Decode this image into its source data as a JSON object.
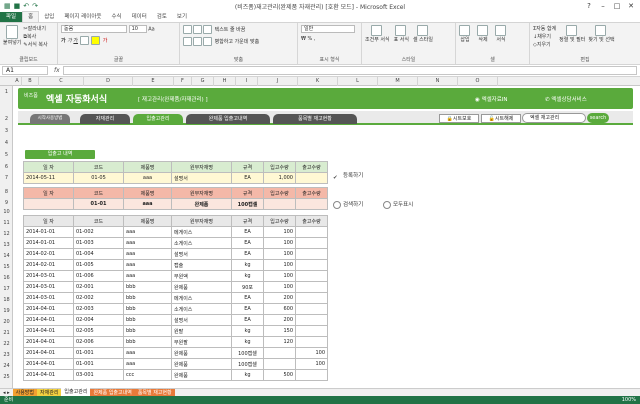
{
  "window": {
    "title": "(비즈폼)재고관리(완제품 자재관리) [호환 모드] - Microsoft Excel"
  },
  "tabs": [
    "파일",
    "홈",
    "삽입",
    "페이지 레이아웃",
    "수식",
    "데이터",
    "검토",
    "보기"
  ],
  "ribbon": {
    "clipboard": {
      "label": "클립보드",
      "paste": "붙여넣기",
      "cut": "잘라내기",
      "copy": "복사",
      "format_painter": "서식 복사"
    },
    "font": {
      "label": "글꼴",
      "font_name": "돋움",
      "font_size": "10"
    },
    "align": {
      "label": "맞춤",
      "wrap": "텍스트 줄 바꿈",
      "merge": "병합하고 가운데 맞춤"
    },
    "number": {
      "label": "표시 형식",
      "format": "일반"
    },
    "styles": {
      "label": "스타일",
      "cond": "조건부 서식",
      "table": "표 서식",
      "cell": "셀 스타일"
    },
    "cells": {
      "label": "셀",
      "insert": "삽입",
      "delete": "삭제",
      "format": "서식"
    },
    "edit": {
      "label": "편집",
      "autosum": "자동 합계",
      "fill": "채우기",
      "clear": "지우기",
      "sort": "정렬 및 필터",
      "find": "찾기 및 선택"
    }
  },
  "formula": {
    "namebox": "A1",
    "fx": "fx"
  },
  "columns": [
    "A",
    "B",
    "C",
    "D",
    "E",
    "F",
    "G",
    "H",
    "I",
    "J",
    "K",
    "L",
    "M",
    "N",
    "O"
  ],
  "rows": [
    "1",
    "2",
    "3",
    "4",
    "5",
    "6",
    "7",
    "8",
    "9",
    "10",
    "11",
    "12",
    "13",
    "14",
    "15",
    "16",
    "17",
    "18",
    "19",
    "20",
    "21",
    "22",
    "23",
    "24",
    "25",
    "26",
    "27",
    "28",
    "29"
  ],
  "banner": {
    "logo": "비즈폼",
    "title": "엑셀 자동화서식",
    "subtitle": "[ 재고관리(완제품/자재관리) ]",
    "brand1": "엑셀자료IN",
    "brand2": "엑셀상담서비스"
  },
  "nav": {
    "tabs": [
      "시작사용방법",
      "자재관리",
      "입출고관리",
      "완제품 입출고내역",
      "품목별 재고현황"
    ],
    "protect": "시트보호",
    "unprotect": "시트해제",
    "search_placeholder": "엑셀 재고관리",
    "search_btn": "search"
  },
  "section": {
    "label": "입출고 내역"
  },
  "input_table": {
    "headers": [
      "일 자",
      "코드",
      "제품명",
      "원부자재명",
      "규격",
      "입고수량",
      "출고수량"
    ],
    "row": [
      "2014-05-11",
      "01-05",
      "aaa",
      "설명서",
      "EA",
      "1,000",
      ""
    ]
  },
  "register_btn": "등록하기",
  "search_table": {
    "headers": [
      "일 자",
      "코드",
      "제품명",
      "원부자재명",
      "규격",
      "입고수량",
      "출고수량"
    ],
    "row": [
      "",
      "01-01",
      "aaa",
      "완제품",
      "100캡셀",
      "",
      ""
    ]
  },
  "search_btn": "검색하기",
  "showall_btn": "모두표시",
  "list_table": {
    "headers": [
      "일 자",
      "코드",
      "제품명",
      "원부자재명",
      "규격",
      "입고수량",
      "출고수량"
    ],
    "rows": [
      [
        "2014-01-01",
        "01-002",
        "aaa",
        "메게이스",
        "EA",
        "100",
        ""
      ],
      [
        "2014-01-01",
        "01-003",
        "aaa",
        "소게이스",
        "EA",
        "100",
        ""
      ],
      [
        "2014-02-01",
        "01-004",
        "aaa",
        "설명서",
        "EA",
        "100",
        ""
      ],
      [
        "2014-02-01",
        "01-005",
        "aaa",
        "캡슐",
        "kg",
        "100",
        ""
      ],
      [
        "2014-03-01",
        "01-006",
        "aaa",
        "부원액",
        "kg",
        "100",
        ""
      ],
      [
        "2014-03-01",
        "02-001",
        "bbb",
        "완제품",
        "90포",
        "100",
        ""
      ],
      [
        "2014-03-01",
        "02-002",
        "bbb",
        "메게이스",
        "EA",
        "200",
        ""
      ],
      [
        "2014-04-01",
        "02-003",
        "bbb",
        "소게이스",
        "EA",
        "600",
        ""
      ],
      [
        "2014-04-01",
        "02-004",
        "bbb",
        "설명서",
        "EA",
        "200",
        ""
      ],
      [
        "2014-04-01",
        "02-005",
        "bbb",
        "원팔",
        "kg",
        "150",
        ""
      ],
      [
        "2014-04-01",
        "02-006",
        "bbb",
        "부원팔",
        "kg",
        "120",
        ""
      ],
      [
        "2014-04-01",
        "01-001",
        "aaa",
        "완제품",
        "100캡셀",
        "",
        "100"
      ],
      [
        "2014-04-01",
        "01-001",
        "aaa",
        "완제품",
        "100캡셀",
        "",
        "100"
      ],
      [
        "2014-04-01",
        "03-001",
        "ccc",
        "완제품",
        "kg",
        "500",
        ""
      ]
    ]
  },
  "sheet_tabs": [
    "사용방법",
    "자재관리",
    "입출고관리",
    "완제품 입출고내역",
    "품목별 재고현황"
  ],
  "status": {
    "ready": "준비",
    "zoom": "100%"
  }
}
